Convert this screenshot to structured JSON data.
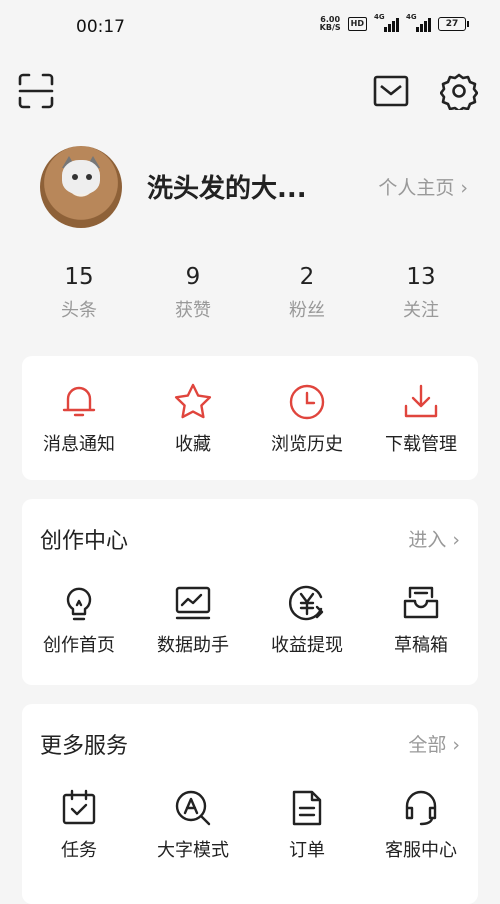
{
  "status_bar": {
    "time": "00:17",
    "speed_value": "6.00",
    "speed_unit": "KB/S",
    "hd_badge": "HD",
    "signal_1_label": "4G",
    "signal_2_label": "4G",
    "battery": "27"
  },
  "header": {
    "scan_icon": "scan-icon",
    "message_icon": "mail-icon",
    "settings_icon": "gear-icon"
  },
  "profile": {
    "name": "洗头发的大...",
    "homepage_link": "个人主页 ›"
  },
  "stats": [
    {
      "value": "15",
      "label": "头条"
    },
    {
      "value": "9",
      "label": "获赞"
    },
    {
      "value": "2",
      "label": "粉丝"
    },
    {
      "value": "13",
      "label": "关注"
    }
  ],
  "quick_actions": [
    {
      "label": "消息通知",
      "icon": "bell-icon"
    },
    {
      "label": "收藏",
      "icon": "star-icon"
    },
    {
      "label": "浏览历史",
      "icon": "clock-icon"
    },
    {
      "label": "下载管理",
      "icon": "download-icon"
    }
  ],
  "creation_center": {
    "title": "创作中心",
    "enter_link": "进入 ›",
    "items": [
      {
        "label": "创作首页",
        "icon": "lightbulb-icon"
      },
      {
        "label": "数据助手",
        "icon": "chart-monitor-icon"
      },
      {
        "label": "收益提现",
        "icon": "yuan-icon"
      },
      {
        "label": "草稿箱",
        "icon": "inbox-icon"
      }
    ]
  },
  "more_services": {
    "title": "更多服务",
    "all_link": "全部 ›",
    "items": [
      {
        "label": "任务",
        "icon": "task-icon"
      },
      {
        "label": "大字模式",
        "icon": "magnifier-a-icon"
      },
      {
        "label": "订单",
        "icon": "order-icon"
      },
      {
        "label": "客服中心",
        "icon": "headset-icon"
      }
    ]
  },
  "colors": {
    "accent_red": "#e0453d",
    "text_dark": "#222222",
    "text_gray": "#999999",
    "background": "#f5f5f5"
  }
}
